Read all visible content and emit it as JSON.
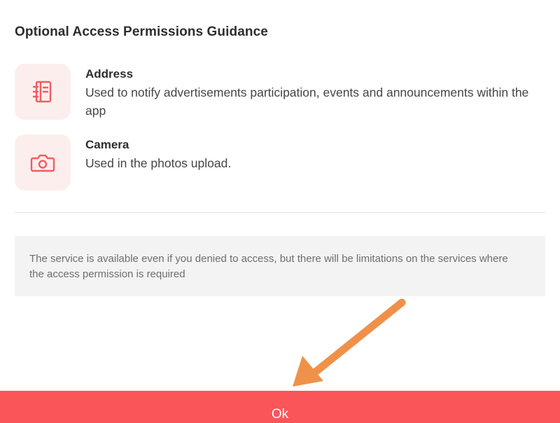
{
  "dialog": {
    "title": "Optional Access Permissions Guidance",
    "accent_color": "#fa5558",
    "permissions": [
      {
        "icon": "notebook-icon",
        "name": "Address",
        "description": "Used to notify advertisements participation, events and announcements within the app"
      },
      {
        "icon": "camera-icon",
        "name": "Camera",
        "description": "Used in the photos upload."
      }
    ],
    "notice": "The service is available even if you denied to access, but there will be limitations on the services where the access permission is required",
    "ok_label": "Ok"
  },
  "annotation": {
    "icon": "arrow-pointer-icon",
    "color": "#f0914a"
  }
}
